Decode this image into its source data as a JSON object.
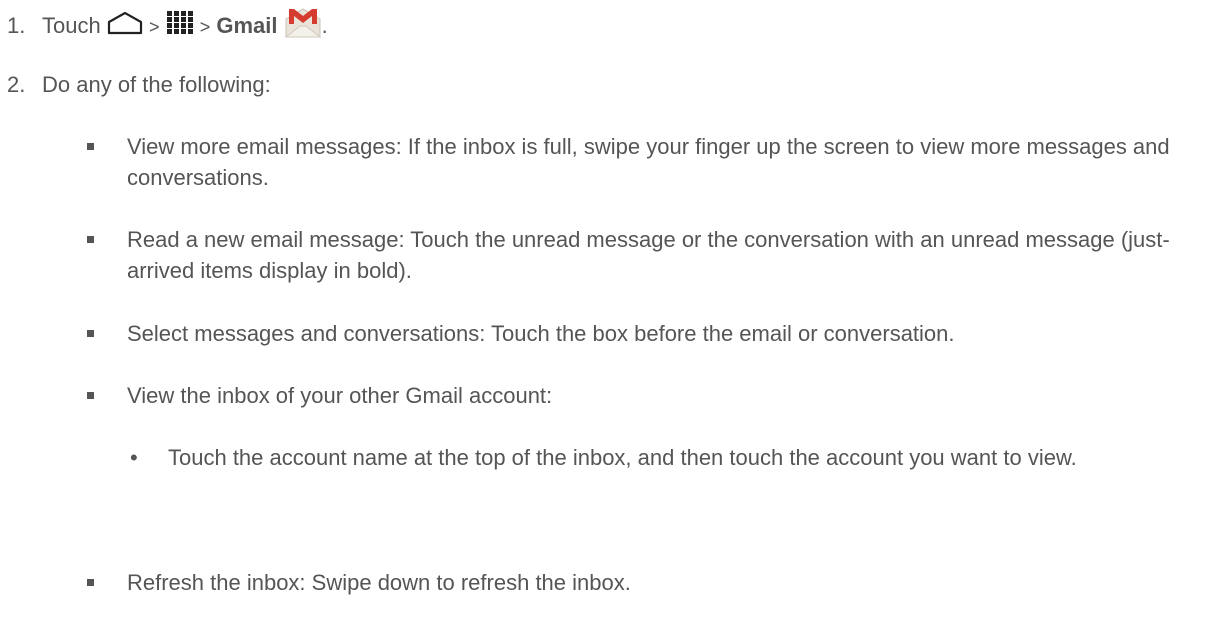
{
  "steps": [
    {
      "number": "1.",
      "touch": "Touch",
      "sep1": ">",
      "sep2": ">",
      "app": "Gmail",
      "end": ".",
      "icons": [
        "home-icon",
        "apps-grid-icon",
        "gmail-icon"
      ]
    },
    {
      "number": "2.",
      "text": "Do any of the following:"
    }
  ],
  "bullets": [
    "View more email messages: If the inbox is full, swipe your finger up the screen to view more messages and conversations.",
    "Read a new email message: Touch the unread message or the conversation with an unread message (just-arrived items display in bold).",
    "Select messages and conversations: Touch the box before the email or conversation.",
    "View the inbox of your other Gmail account:",
    "Refresh the inbox: Swipe down to refresh the inbox."
  ],
  "sub_bullets": [
    {
      "mark": "•",
      "text": "Touch the account name at the top of the inbox, and then touch the account you want to view."
    }
  ],
  "colors": {
    "text": "#555555",
    "gmail_red": "#d63b2f"
  }
}
